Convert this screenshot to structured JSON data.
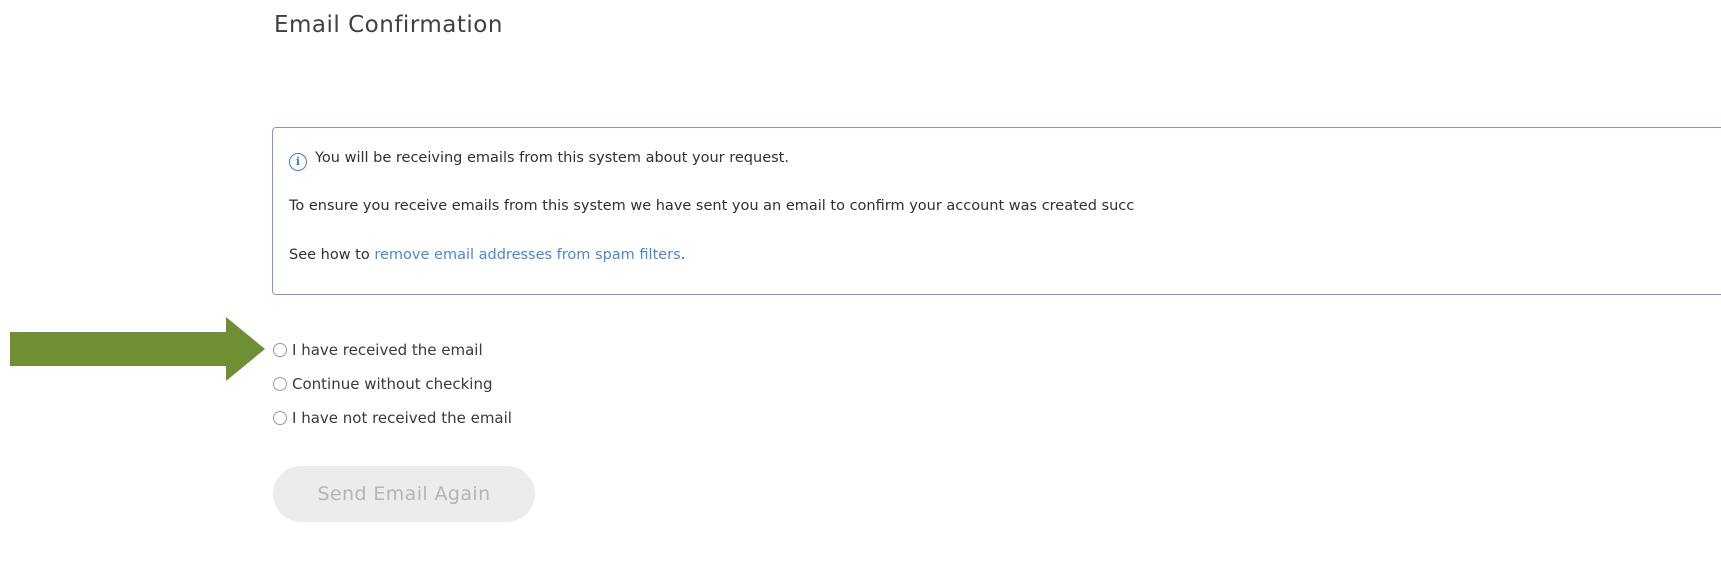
{
  "page": {
    "title": "Email Confirmation"
  },
  "info_box": {
    "icon": "info-icon",
    "line1": "You will be receiving emails from this system about your request.",
    "line2": "To ensure you receive emails from this system we have sent you an email to confirm your account was created succ",
    "line3_prefix": "See how to ",
    "line3_link": "remove email addresses from spam filters",
    "line3_suffix": "."
  },
  "radio_options": [
    {
      "label": "I have received the email",
      "selected": false
    },
    {
      "label": "Continue without checking",
      "selected": false
    },
    {
      "label": "I have not received the email",
      "selected": false
    }
  ],
  "send_button": {
    "label": "Send Email Again",
    "disabled": true
  },
  "colors": {
    "arrow": "#6f8f35",
    "info_border": "#7d96d4",
    "link": "#4a86e0",
    "button_bg": "#ececec",
    "button_text": "#b4b4b4"
  }
}
